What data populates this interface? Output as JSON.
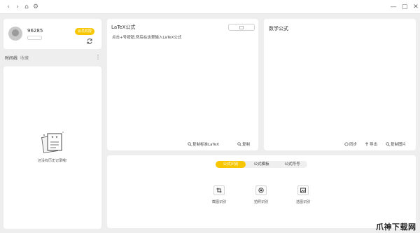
{
  "profile": {
    "user_id": "96285",
    "vip_label": "会员权限"
  },
  "timeline": {
    "title": "时间线",
    "sub": "收藏",
    "empty_text": "还没有历史记录哦!"
  },
  "latex_panel": {
    "title": "LaTeX公式",
    "hint": "点击+号按钮,然后在这里输入LaTeX公式",
    "copy_standard": "复制标准LaTeX",
    "copy": "复制"
  },
  "math_panel": {
    "title": "数学公式",
    "sync": "同步",
    "export": "导出",
    "copy_image": "复制图片"
  },
  "tabs": [
    {
      "label": "公式识别",
      "active": true
    },
    {
      "label": "公式模板",
      "active": false
    },
    {
      "label": "公式符号",
      "active": false
    }
  ],
  "tools": [
    {
      "label": "截图识别",
      "icon": "crop-icon"
    },
    {
      "label": "拍照识别",
      "icon": "camera-icon"
    },
    {
      "label": "选图识别",
      "icon": "image-icon"
    }
  ],
  "watermark": "爪神下载网",
  "colors": {
    "accent": "#f7c600",
    "panel": "#ffffff",
    "background": "#eeeeee"
  }
}
